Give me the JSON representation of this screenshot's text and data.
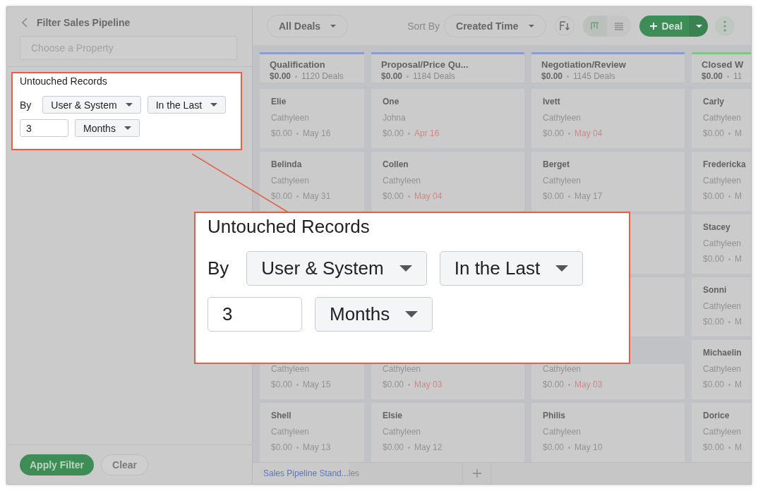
{
  "sidebar": {
    "title": "Filter Sales Pipeline",
    "property_field": {
      "placeholder": "Choose a Property"
    },
    "filter": {
      "label": "Untouched Records",
      "by_label": "By",
      "by": "User & System",
      "condition": "In the Last",
      "amount": "3",
      "unit": "Months"
    },
    "buttons": [
      {
        "label": "Apply Filter",
        "kind": "primary"
      },
      {
        "label": "Clear",
        "kind": "secondary"
      }
    ]
  },
  "toolbar": {
    "view": "All Deals",
    "sort_label": "Sort By",
    "sort": "Created Time",
    "view_modes": [
      {
        "kind": "kanban",
        "selected": true
      },
      {
        "kind": "list",
        "selected": false
      }
    ],
    "new_button": "Deal"
  },
  "columns": [
    {
      "title": "Qualification",
      "amount": "$0.00",
      "count": "1120 Deals",
      "color": "#8a9fc6",
      "cards": [
        {
          "name": "Elie",
          "owner": "Cathyleen",
          "amount": "$0.00",
          "date": "May 16",
          "overdue": false
        },
        {
          "name": "Belinda",
          "owner": "Cathyleen",
          "amount": "$0.00",
          "date": "May 31",
          "overdue": false
        },
        {
          "owner": "Cathyleen",
          "amount": "$0.00",
          "date": "May 15",
          "overdue": false
        },
        {
          "name": "Shell",
          "owner": "Cathyleen",
          "amount": "$0.00",
          "date": "May 13",
          "overdue": false
        }
      ]
    },
    {
      "title": "Proposal/Price Qu...",
      "amount": "$0.00",
      "count": "1184 Deals",
      "color": "#8a9fc6",
      "cards": [
        {
          "name": "One",
          "owner": "Johna",
          "amount": "$0.00",
          "date": "Apr 16",
          "overdue": true
        },
        {
          "name": "Collen",
          "owner": "Cathyleen",
          "amount": "$0.00",
          "date": "May 04",
          "overdue": true
        },
        {
          "owner": "Cathyleen",
          "amount": "$0.00",
          "date": "May 03",
          "overdue": true
        },
        {
          "name": "Elsie",
          "owner": "Cathyleen",
          "amount": "$0.00",
          "date": "May 12",
          "overdue": false
        }
      ]
    },
    {
      "title": "Negotiation/Review",
      "amount": "$0.00",
      "count": "1145 Deals",
      "color": "#8a9fc6",
      "cards": [
        {
          "name": "Ivett",
          "owner": "Cathyleen",
          "amount": "$0.00",
          "date": "May 04",
          "overdue": true
        },
        {
          "name": "Berget",
          "owner": "Cathyleen",
          "amount": "$0.00",
          "date": "May 17",
          "overdue": false
        },
        {
          "kind": "covered"
        },
        {
          "kind": "covered"
        },
        {
          "owner": "Cathyleen",
          "amount": "$0.00",
          "date": "May 03",
          "overdue": true
        },
        {
          "name": "Philis",
          "owner": "Cathyleen",
          "amount": "$0.00",
          "date": "May 10",
          "overdue": false
        }
      ]
    },
    {
      "title": "Closed W",
      "amount": "$0.00",
      "count": "11",
      "color": "#86c08f",
      "cards": [
        {
          "name": "Carly",
          "owner": "Cathyleen",
          "amount": "$0.00",
          "date": "M",
          "overdue": false
        },
        {
          "name": "Fredericka",
          "owner": "Cathyleen",
          "amount": "$0.00",
          "date": "M",
          "overdue": false
        },
        {
          "name": "Stacey",
          "owner": "Cathyleen",
          "amount": "$0.00",
          "date": "M",
          "overdue": false
        },
        {
          "name": "Sonni",
          "owner": "Cathyleen",
          "amount": "$0.00",
          "date": "M",
          "overdue": false
        },
        {
          "name": "Michaelin",
          "owner": "Cathyleen",
          "amount": "$0.00",
          "date": "M",
          "overdue": false
        },
        {
          "name": "Dorice",
          "owner": "Cathyleen",
          "amount": "$0.00",
          "date": "M",
          "overdue": false
        }
      ]
    }
  ],
  "footer": {
    "tab": "Sales Pipeline Stand...",
    "tab_overflow": "les"
  },
  "callout": {
    "label": "Untouched Records",
    "by_label": "By",
    "by": "User & System",
    "condition": "In the Last",
    "amount": "3",
    "unit": "Months"
  }
}
